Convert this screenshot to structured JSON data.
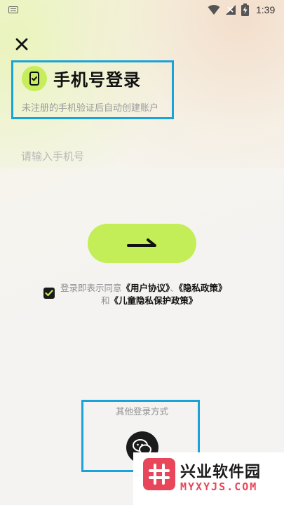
{
  "status_bar": {
    "time": "1:39",
    "icons": [
      "keyboard-icon",
      "wifi-icon",
      "signal-icon",
      "battery-charging-icon"
    ]
  },
  "header": {
    "close_icon": "close-icon",
    "icon": "phone-shield-icon",
    "title": "手机号登录",
    "subtitle": "未注册的手机验证后自动创建账户"
  },
  "phone_input": {
    "placeholder": "请输入手机号",
    "value": ""
  },
  "submit_button": {
    "icon": "arrow-right-icon"
  },
  "agreement": {
    "checked": true,
    "prefix": "登录即表示同意",
    "user_agreement": "《用户协议》",
    "separator": "、",
    "privacy_policy": "《隐私政策》",
    "and": "和",
    "child_privacy_policy": "《儿童隐私保护政策》"
  },
  "other_login": {
    "label": "其他登录方式",
    "icon": "wechat-icon"
  },
  "watermark": {
    "title": "兴业软件园",
    "url": "MYXYJS.COM"
  },
  "colors": {
    "accent_green": "#c3ee57",
    "highlight_blue": "#1aa3d8",
    "watermark_red": "#e8465a"
  }
}
